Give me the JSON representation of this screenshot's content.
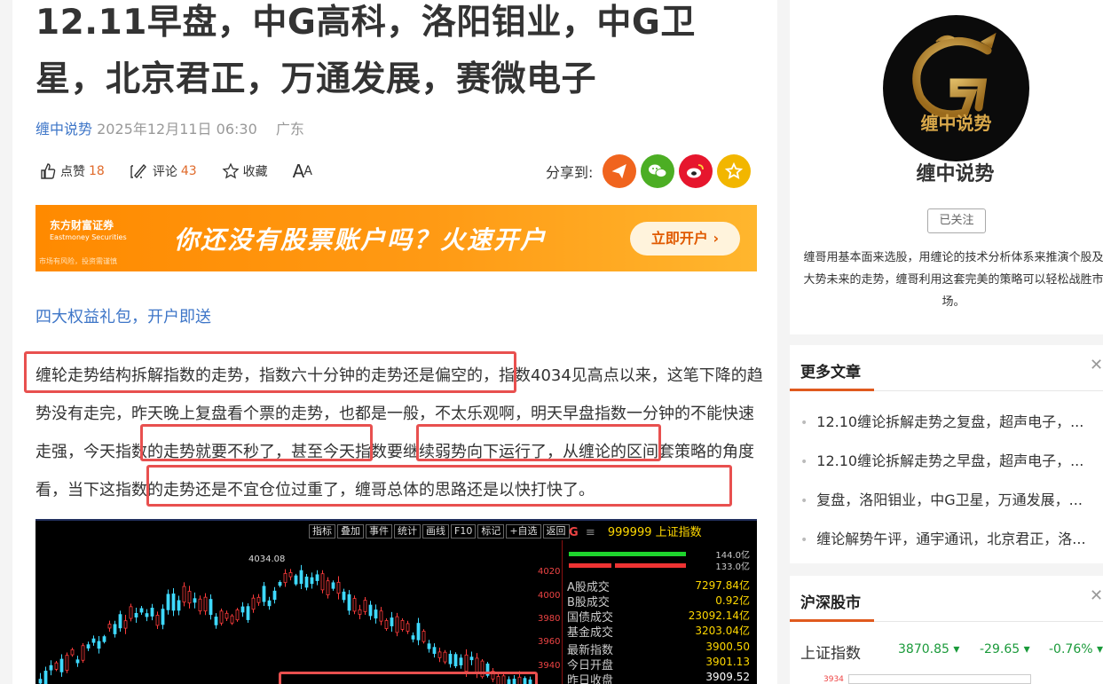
{
  "article": {
    "title": "12.11早盘，中G高科，洛阳钼业，中G卫星，北京君正，万通发展，赛微电子",
    "author": "缠中说势",
    "datetime": "2025年12月11日 06:30",
    "location": "广东"
  },
  "actions": {
    "like_label": "点赞",
    "like_count": "18",
    "comment_label": "评论",
    "comment_count": "43",
    "fav_label": "收藏",
    "font_label_big": "A",
    "font_label_small": "A",
    "share_label": "分享到:"
  },
  "banner": {
    "logo": "东方财富证券",
    "logo_en": "Eastmoney Securities",
    "risk": "市场有风险，投资需谨慎",
    "slogan": "你还没有股票账户吗？火速开户",
    "button": "立即开户 ›"
  },
  "promo_link": "四大权益礼包，开户即送",
  "paragraph": {
    "s1": "缠轮走势结构拆解指数的走势，指数六十分钟的走势还是偏空的",
    "s2": "，指数4034见高点以来，这笔下降的趋势没有走完，昨天晚上复盘看个票的走势，也都是一般，不太乐观啊，明天早盘指数一分钟的不能快速走强，",
    "s3": "今天指数的走势就要不秒了",
    "s4": "，甚至",
    "s5": "今天指数要继续弱势向下运行了",
    "s6": "，从缠论的区间套策略的角度看，当下这指数的走势还是不宜仓位过重了，缠哥总体的思路还是以快打快了。"
  },
  "stock_chart": {
    "toolbar": [
      "指标",
      "叠加",
      "事件",
      "统计",
      "画线",
      "F10",
      "标记",
      "+自选",
      "返回"
    ],
    "peak_label": "4034.08",
    "y_labels": [
      "4020",
      "4000",
      "3980",
      "3960",
      "3940"
    ],
    "side_header_g": "G",
    "side_header_menu": "≡",
    "side_header_code": "999999",
    "side_header_name": "上证指数",
    "bar_values": [
      "144.0亿",
      "133.0亿"
    ],
    "rows": [
      {
        "label": "A股成交",
        "value": "7297.84亿"
      },
      {
        "label": "B股成交",
        "value": "0.92亿"
      },
      {
        "label": "国债成交",
        "value": "23092.14亿"
      },
      {
        "label": "基金成交",
        "value": "3203.04亿"
      },
      {
        "label": "最新指数",
        "value": "3900.50"
      },
      {
        "label": "今日开盘",
        "value": "3901.13"
      },
      {
        "label": "昨日收盘",
        "value": "3909.52"
      }
    ],
    "colors": {
      "up": "#ff3b3b",
      "down": "#3fd9ff",
      "background": "#000000"
    }
  },
  "profile": {
    "avatar_text": "缠中说势",
    "name": "缠中说势",
    "follow_label": "已关注",
    "description": "缠哥用基本面来选股，用缠论的技术分析体系来推演个股及大势未来的走势，缠哥利用这套完美的策略可以轻松战胜市场。"
  },
  "more_articles": {
    "title": "更多文章",
    "close": "✕",
    "items": [
      "12.10缠论拆解走势之复盘，超声电子，...",
      "12.10缠论拆解走势之早盘，超声电子，...",
      "复盘，洛阳钼业，中G卫星，万通发展，...",
      "缠论解势午评，通宇通讯，北京君正，洛..."
    ]
  },
  "market": {
    "title": "沪深股市",
    "close": "✕",
    "index_name": "上证指数",
    "index_value": "3870.85",
    "index_change": "-29.65",
    "index_pct": "-0.76%",
    "mini_label": "3934"
  }
}
